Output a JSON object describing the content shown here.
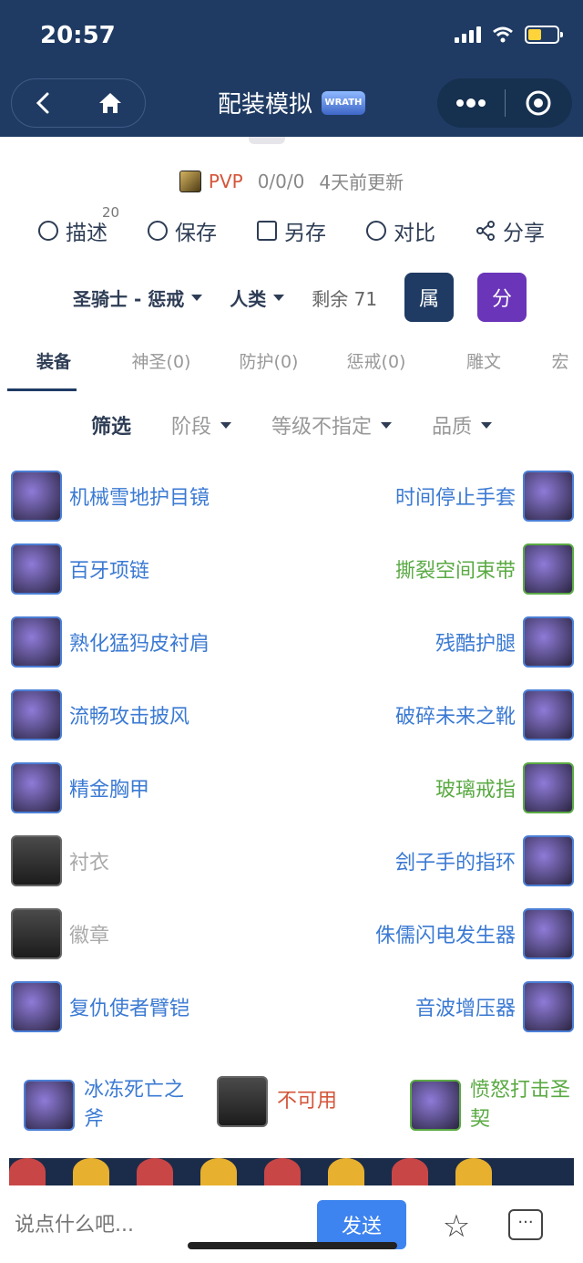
{
  "status": {
    "time": "20:57"
  },
  "nav": {
    "title": "配装模拟",
    "logo_text": "WRATH"
  },
  "info": {
    "mode": "PVP",
    "score": "0/0/0",
    "updated": "4天前更新"
  },
  "actions": [
    {
      "label": "描述",
      "badge": "20"
    },
    {
      "label": "保存"
    },
    {
      "label": "另存"
    },
    {
      "label": "对比"
    },
    {
      "label": "分享"
    }
  ],
  "class_row": {
    "class": "圣骑士 - 惩戒",
    "race": "人类",
    "remaining": "剩余 71",
    "attr_btn": "属",
    "score_btn": "分"
  },
  "tabs": [
    "装备",
    "神圣(0)",
    "防护(0)",
    "惩戒(0)",
    "雕文",
    "宏"
  ],
  "filters": {
    "label": "筛选",
    "stage": "阶段",
    "level": "等级不指定",
    "quality": "品质"
  },
  "gear": [
    {
      "left": {
        "name": "机械雪地护目镜",
        "quality": "blue"
      },
      "right": {
        "name": "时间停止手套",
        "quality": "blue"
      }
    },
    {
      "left": {
        "name": "百牙项链",
        "quality": "blue"
      },
      "right": {
        "name": "撕裂空间束带",
        "quality": "green"
      }
    },
    {
      "left": {
        "name": "熟化猛犸皮衬肩",
        "quality": "blue"
      },
      "right": {
        "name": "残酷护腿",
        "quality": "blue"
      }
    },
    {
      "left": {
        "name": "流畅攻击披风",
        "quality": "blue"
      },
      "right": {
        "name": "破碎未来之靴",
        "quality": "blue"
      }
    },
    {
      "left": {
        "name": "精金胸甲",
        "quality": "blue"
      },
      "right": {
        "name": "玻璃戒指",
        "quality": "green"
      }
    },
    {
      "left": {
        "name": "衬衣",
        "quality": "empty"
      },
      "right": {
        "name": "刽子手的指环",
        "quality": "blue"
      }
    },
    {
      "left": {
        "name": "徽章",
        "quality": "empty"
      },
      "right": {
        "name": "侏儒闪电发生器",
        "quality": "blue"
      }
    },
    {
      "left": {
        "name": "复仇使者臂铠",
        "quality": "blue"
      },
      "right": {
        "name": "音波增压器",
        "quality": "blue"
      }
    }
  ],
  "weapons": [
    {
      "name_line1": "冰冻死亡之",
      "name_line2": "斧",
      "quality": "blue"
    },
    {
      "name_line1": "不可用",
      "name_line2": "",
      "quality": "red"
    },
    {
      "name_line1": "愤怒打击圣",
      "name_line2": "契",
      "quality": "green"
    }
  ],
  "bottom": {
    "placeholder": "说点什么吧...",
    "send": "发送"
  },
  "colors": {
    "header": "#1f3b63",
    "blue_item": "#3b7ad3",
    "green_item": "#5aaa43",
    "red": "#d4553a",
    "purple": "#6a35b9",
    "send": "#3e84f0"
  }
}
